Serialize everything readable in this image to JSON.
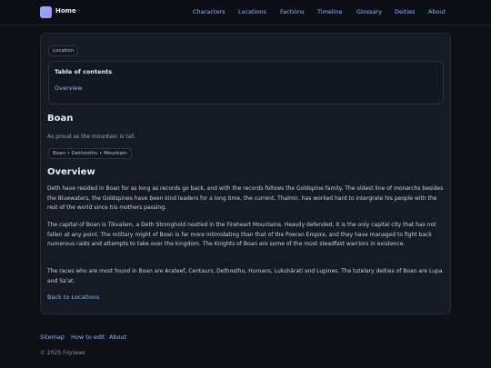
{
  "header": {
    "brand": "Home",
    "nav": [
      "Characters",
      "Locations",
      "Factions",
      "Timeline",
      "Glossary",
      "Deities",
      "About"
    ]
  },
  "article": {
    "badge": "Location",
    "toc": {
      "title": "Table of contents",
      "items": [
        "Overview"
      ]
    },
    "title": "Boan",
    "tagline": "As proud as the mountain is tall.",
    "tags": "Boan • Dethosthu • Mountain",
    "section_title": "Overview",
    "paragraphs": [
      "Deth have resided in Boan for as long as records go back, and with the records follows the Goldspine family. The oldest line of monarchs besides the Bluewaters, the Goldspines have been kind leaders for a long time, the current, Thalmir, has worked hard to intergrate his people with the rest of the world since his mothers passing.",
      "The capital of Boan is Tikvalem, a Deth Stronghold nestled in the Fireheart Mountains. Heavily defended, it is the only capital city that has not fallen at any point. The military might of Boan is far more intimidating than that of the Poeran Empire, and they have managed to fight back numerous raids and attempts to take over the kingdom. The Knights of Boan are some of the most steadfast warriors in existence.",
      "The races who are most found in Boan are Arateef, Centaurs, Dethosthu, Humans, Lukshārati and Lupines. The tutelary deities of Boan are Lupa and Sa'at."
    ],
    "back_link": "Back to Locations"
  },
  "footer": {
    "links": [
      "Sitemap",
      "How to edit",
      "About"
    ],
    "copyright": "© 2025 Foyiwae"
  }
}
